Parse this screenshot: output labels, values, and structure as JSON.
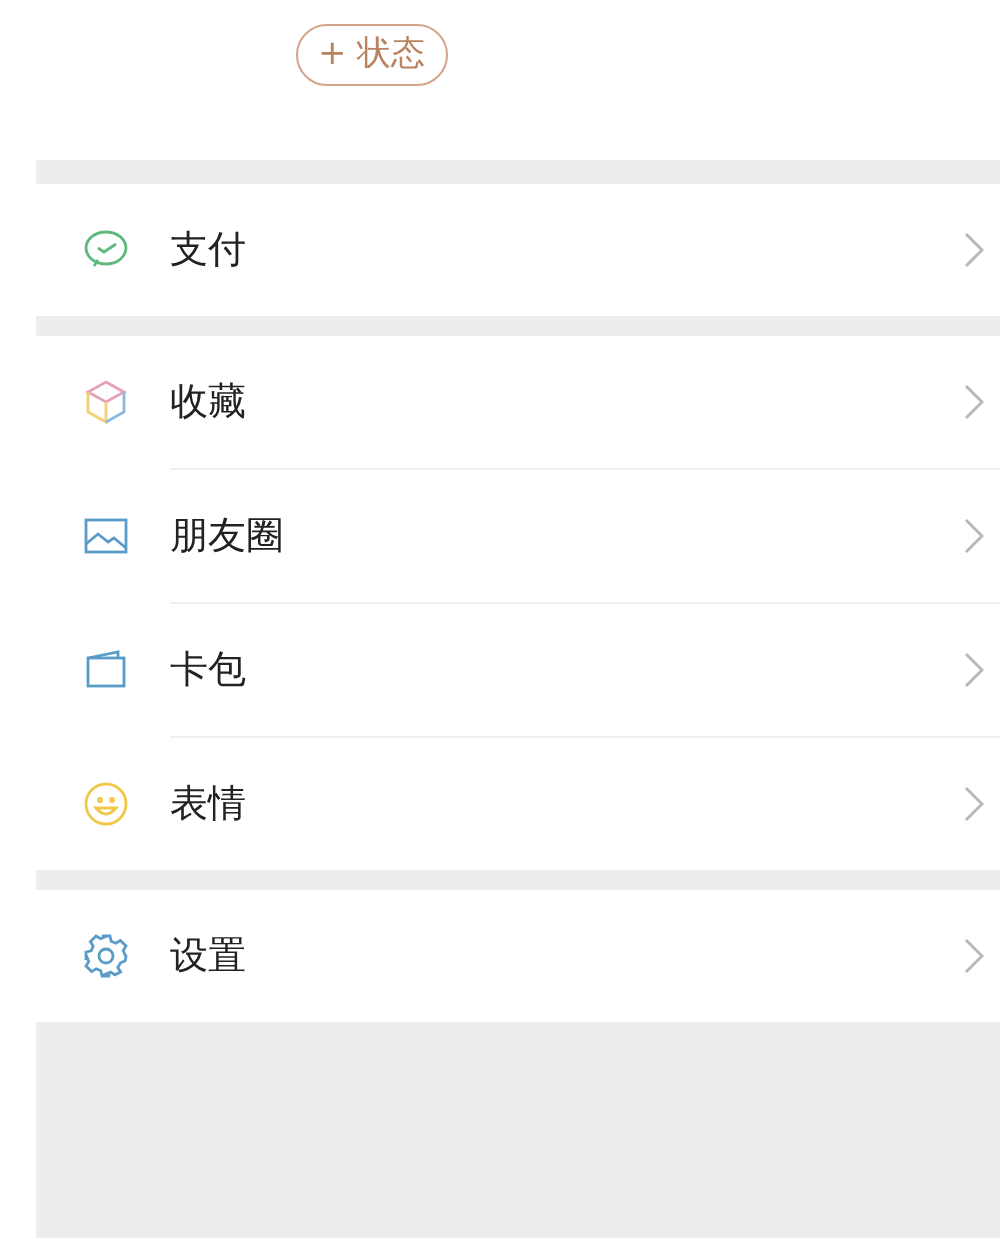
{
  "status_button": {
    "label": "+ 状态"
  },
  "groups": [
    {
      "items": [
        {
          "kind": "pay",
          "label": "支付"
        }
      ]
    },
    {
      "items": [
        {
          "kind": "favorites",
          "label": "收藏"
        },
        {
          "kind": "moments",
          "label": "朋友圈"
        },
        {
          "kind": "cards",
          "label": "卡包"
        },
        {
          "kind": "stickers",
          "label": "表情"
        }
      ]
    },
    {
      "items": [
        {
          "kind": "settings",
          "label": "设置"
        }
      ]
    }
  ]
}
